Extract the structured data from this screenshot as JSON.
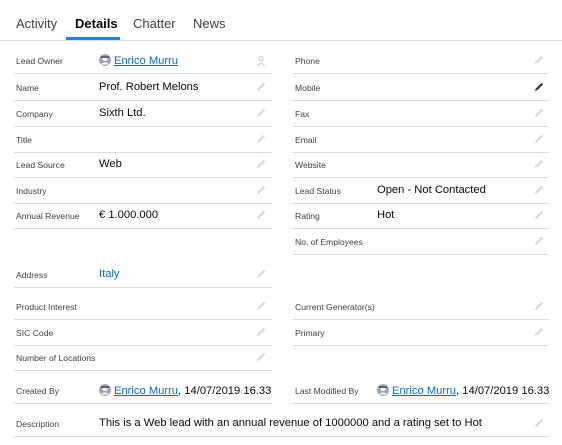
{
  "tabs": [
    {
      "label": "Activity"
    },
    {
      "label": "Details"
    },
    {
      "label": "Chatter"
    },
    {
      "label": "News"
    }
  ],
  "left": {
    "lead_owner": {
      "label": "Lead Owner",
      "value": "Enrico Murru"
    },
    "name": {
      "label": "Name",
      "value": "Prof. Robert Melons"
    },
    "company": {
      "label": "Company",
      "value": "Sixth Ltd."
    },
    "title": {
      "label": "Title",
      "value": ""
    },
    "lead_source": {
      "label": "Lead Source",
      "value": "Web"
    },
    "industry": {
      "label": "Industry",
      "value": ""
    },
    "annual_revenue": {
      "label": "Annual Revenue",
      "value": "€ 1.000.000"
    },
    "address": {
      "label": "Address",
      "value": "Italy"
    },
    "product_interest": {
      "label": "Product Interest",
      "value": ""
    },
    "sic_code": {
      "label": "SIC Code",
      "value": ""
    },
    "number_of_locations": {
      "label": "Number of Locations",
      "value": ""
    },
    "created_by": {
      "label": "Created By",
      "user": "Enrico Murru",
      "date": ", 14/07/2019 16.33"
    }
  },
  "right": {
    "phone": {
      "label": "Phone",
      "value": ""
    },
    "mobile": {
      "label": "Mobile",
      "value": ""
    },
    "fax": {
      "label": "Fax",
      "value": ""
    },
    "email": {
      "label": "Email",
      "value": ""
    },
    "website": {
      "label": "Website",
      "value": ""
    },
    "lead_status": {
      "label": "Lead Status",
      "value": "Open - Not Contacted"
    },
    "rating": {
      "label": "Rating",
      "value": "Hot"
    },
    "no_of_employees": {
      "label": "No. of Employees",
      "value": ""
    },
    "current_generators": {
      "label": "Current Generator(s)",
      "value": ""
    },
    "primary": {
      "label": "Primary",
      "value": ""
    },
    "last_modified_by": {
      "label": "Last Modified By",
      "user": "Enrico Murru",
      "date": ", 14/07/2019 16.33"
    }
  },
  "description": {
    "label": "Description",
    "value": "This is a Web lead with an annual revenue of 1000000 and a rating set to Hot"
  },
  "colors": {
    "link": "#006dcc",
    "tab_active_underline": "#1589ee",
    "border": "#dddbda"
  }
}
